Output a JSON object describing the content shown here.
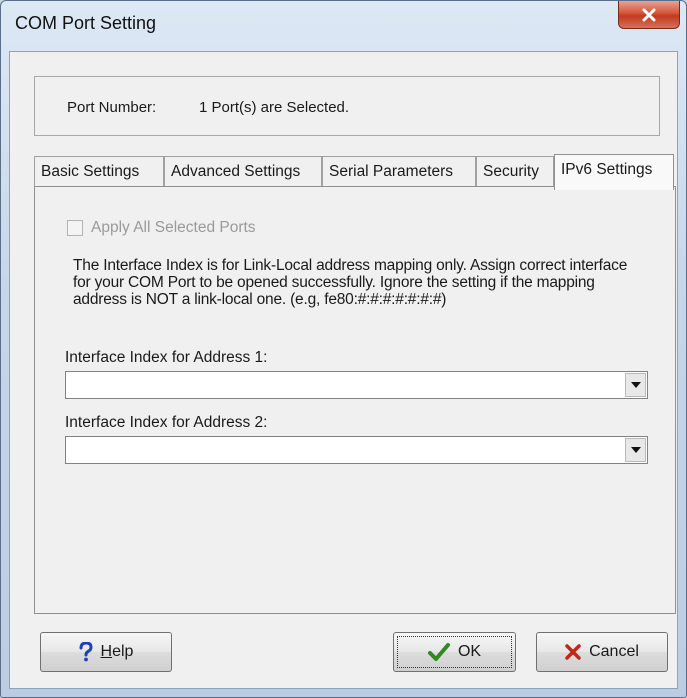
{
  "window": {
    "title": "COM Port Setting",
    "close_icon": "close-x-icon"
  },
  "port": {
    "label": "Port Number:",
    "value": "1 Port(s) are Selected."
  },
  "tabs": [
    {
      "label": "Basic Settings",
      "active": false
    },
    {
      "label": "Advanced Settings",
      "active": false
    },
    {
      "label": "Serial Parameters",
      "active": false
    },
    {
      "label": "Security",
      "active": false
    },
    {
      "label": "IPv6 Settings",
      "active": true
    }
  ],
  "ipv6": {
    "apply_all_label": "Apply All Selected Ports",
    "apply_all_checked": false,
    "apply_all_disabled": true,
    "note": "The Interface Index is for Link-Local address mapping only. Assign correct interface for your COM Port to be opened successfully. Ignore the setting if the mapping address is NOT a link-local one. (e.g, fe80:#:#:#:#:#:#:#)",
    "interface1_label": "Interface Index for Address 1:",
    "interface1_value": "",
    "interface2_label": "Interface Index for Address 2:",
    "interface2_value": ""
  },
  "buttons": {
    "help_prefix": "",
    "help_mnemonic": "H",
    "help_rest": "elp",
    "ok_label": "OK",
    "cancel_label": "Cancel"
  },
  "colors": {
    "help_icon": "#1f3fbf",
    "ok_check": "#2f8a1f",
    "cancel_x": "#c0281a"
  }
}
